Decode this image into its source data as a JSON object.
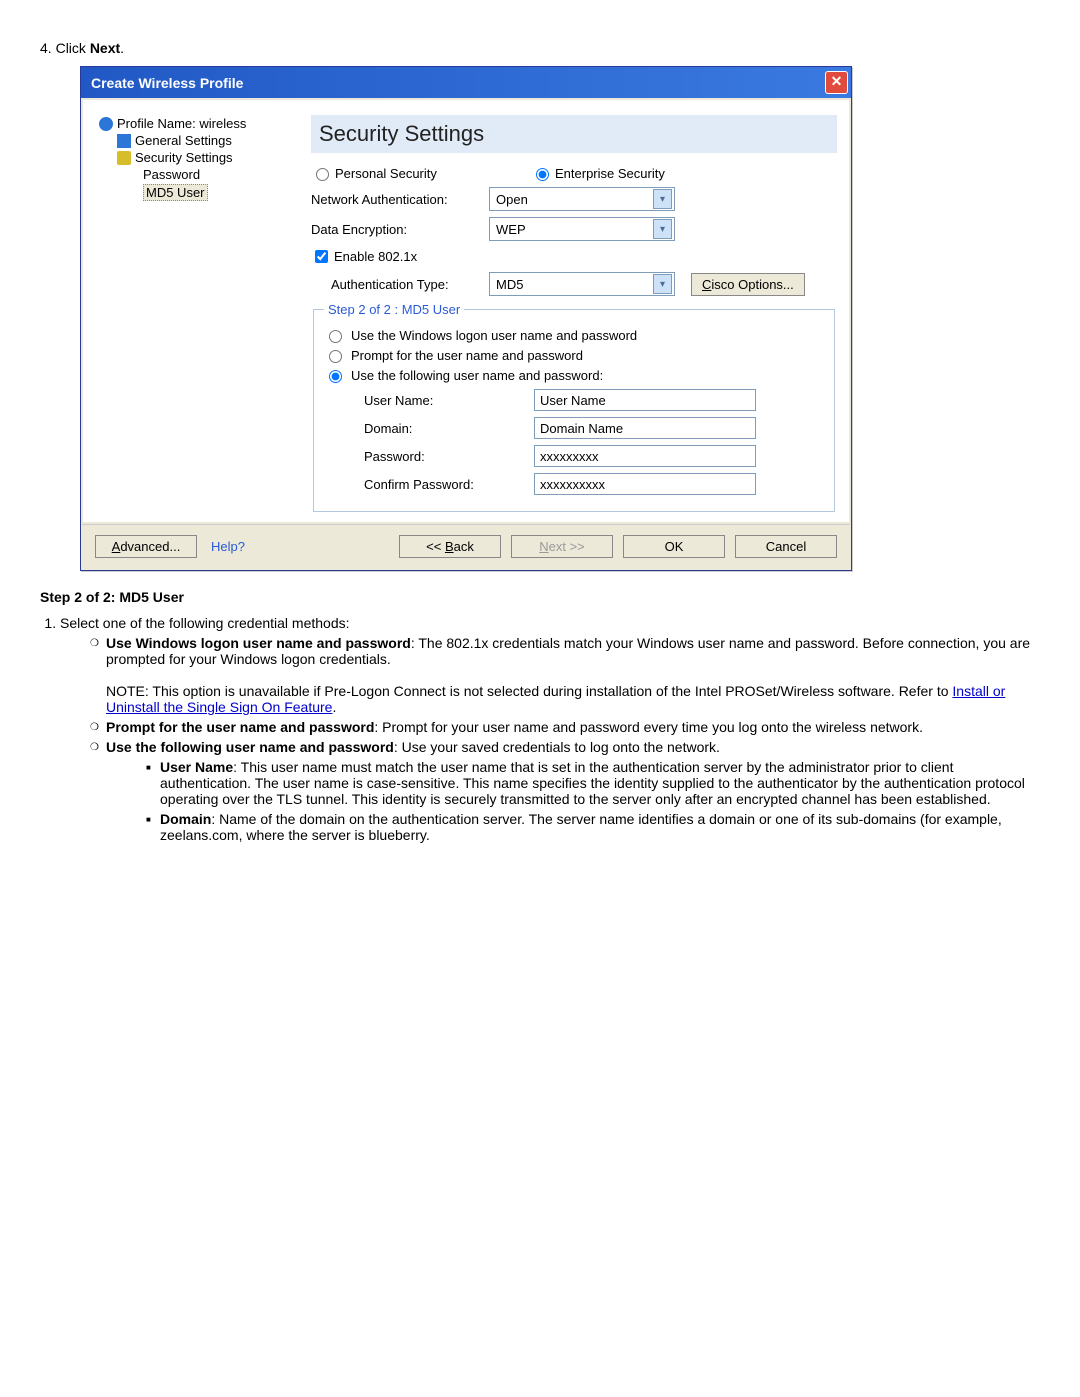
{
  "doc": {
    "pre_step": {
      "num": "4.",
      "text": "Click ",
      "bold": "Next",
      "suffix": "."
    },
    "heading": "Step 2 of 2: MD5 User",
    "list1": {
      "num": "1.",
      "text": "Select one of the following credential methods:"
    },
    "bullet_a": {
      "bold": "Use Windows logon user name and password",
      "text": ": The 802.1x credentials match your Windows user name and password. Before connection, you are prompted for your Windows logon credentials."
    },
    "note": {
      "pre": "NOTE: This option is unavailable if Pre-Logon Connect is not selected during installation of the Intel PROSet/Wireless software. Refer to ",
      "link": "Install or Uninstall the Single Sign On Feature",
      "post": "."
    },
    "bullet_b": {
      "bold": "Prompt for the user name and password",
      "text": ": Prompt for your user name and password every time you log onto the wireless network."
    },
    "bullet_c": {
      "bold": "Use the following user name and password",
      "text": ": Use your saved credentials to log onto the network."
    },
    "sub_user": {
      "bold": "User Name",
      "text": ": This user name must match the user name that is set in the authentication server by the administrator prior to client authentication. The user name is case-sensitive. This name specifies the identity supplied to the authenticator by the authentication protocol operating over the TLS tunnel. This identity is securely transmitted to the server only after an encrypted channel has been established."
    },
    "sub_domain": {
      "bold": "Domain",
      "text": ": Name of the domain on the authentication server. The server name identifies a domain or one of its sub-domains (for example, zeelans.com, where the server is blueberry."
    }
  },
  "dialog": {
    "title": "Create Wireless Profile",
    "tree": {
      "profile": "Profile Name: wireless",
      "general": "General Settings",
      "security": "Security Settings",
      "password": "Password",
      "md5": "MD5 User"
    },
    "header": "Security Settings",
    "radios": {
      "personal": "Personal Security",
      "enterprise": "Enterprise Security"
    },
    "labels": {
      "netauth": "Network Authentication:",
      "dataenc": "Data Encryption:",
      "enable": "Enable 802.1x",
      "authtype": "Authentication Type:",
      "cisco": "Cisco Options..."
    },
    "combos": {
      "netauth": "Open",
      "dataenc": "WEP",
      "authtype": "MD5"
    },
    "group_legend": "Step 2 of 2 : MD5 User",
    "cred_radios": {
      "a": "Use the Windows logon user name and password",
      "b": "Prompt for the user name and password",
      "c": "Use the following user name and password:"
    },
    "fields": {
      "username_lbl": "User Name:",
      "username_val": "User Name",
      "domain_lbl": "Domain:",
      "domain_val": "Domain Name",
      "password_lbl": "Password:",
      "password_val": "xxxxxxxxx",
      "confirm_lbl": "Confirm Password:",
      "confirm_val": "xxxxxxxxxx"
    },
    "footer": {
      "advanced": "Advanced...",
      "help": "Help?",
      "back": "<< Back",
      "next": "Next >>",
      "ok": "OK",
      "cancel": "Cancel"
    }
  }
}
